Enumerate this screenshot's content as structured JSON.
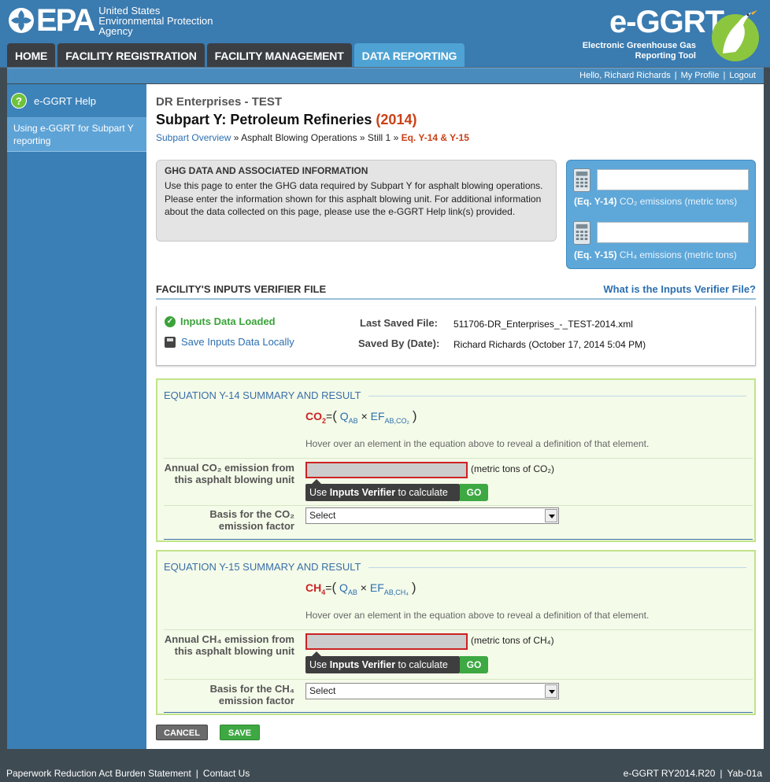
{
  "header": {
    "epa_word": "EPA",
    "agency_line1": "United States",
    "agency_line2": "Environmental Protection",
    "agency_line3": "Agency",
    "app_title": "e-GGRT",
    "app_subtitle_line1": "Electronic Greenhouse Gas",
    "app_subtitle_line2": "Reporting Tool",
    "nav_tabs": [
      "HOME",
      "FACILITY REGISTRATION",
      "FACILITY MANAGEMENT",
      "DATA REPORTING"
    ],
    "active_tab": "DATA REPORTING"
  },
  "userbar": {
    "greeting": "Hello, Richard Richards",
    "profile": "My Profile",
    "logout": "Logout"
  },
  "sidebar": {
    "help_label": "e-GGRT Help",
    "help_icon": "question-icon",
    "link": "Using e-GGRT for Subpart Y reporting"
  },
  "page": {
    "company": "DR Enterprises - TEST",
    "subpart": "Subpart Y: Petroleum Refineries",
    "year": "(2014)",
    "breadcrumb": {
      "overview": "Subpart Overview",
      "sep": "»",
      "step1": "Asphalt Blowing Operations",
      "step2": "Still 1",
      "current": "Eq. Y-14 & Y-15"
    }
  },
  "ghg_box": {
    "title": "GHG DATA AND ASSOCIATED INFORMATION",
    "text": "Use this page to enter the GHG data required by Subpart Y for asphalt blowing operations. Please enter the information shown for this asphalt blowing unit. For additional information about the data collected on this page, please use the e-GGRT Help link(s) provided."
  },
  "calc_box": {
    "y14_eq": "(Eq. Y-14)",
    "y14_label": "CO₂ emissions (metric tons)",
    "y14_value": "",
    "y15_eq": "(Eq. Y-15)",
    "y15_label": "CH₄ emissions (metric tons)",
    "y15_value": ""
  },
  "ivf": {
    "title": "FACILITY'S INPUTS VERIFIER FILE",
    "link": "What is the Inputs Verifier File?",
    "loaded": "Inputs Data Loaded",
    "save_local": "Save Inputs Data Locally",
    "last_saved_label": "Last Saved File:",
    "last_saved_value": "511706-DR_Enterprises_-_TEST-2014.xml",
    "saved_by_label": "Saved By (Date):",
    "saved_by_value": "Richard Richards (October 17, 2014 5:04 PM)"
  },
  "eq14": {
    "title": "EQUATION Y-14 SUMMARY AND RESULT",
    "gas": "CO",
    "gas_sub": "2",
    "q": "Q",
    "q_sub": "AB",
    "ef": "EF",
    "ef_sub": "AB,CO₂",
    "hover_note": "Hover over an element in the equation above to reveal a definition of that element.",
    "field_label": "Annual CO₂ emission from this asphalt blowing unit",
    "field_value": "",
    "unit": "(metric tons of CO₂)",
    "tip_prefix": "Use ",
    "tip_bold": "Inputs Verifier",
    "tip_suffix": " to calculate",
    "go": "GO",
    "basis_label": "Basis for the CO₂ emission factor",
    "basis_value": "Select"
  },
  "eq15": {
    "title": "EQUATION Y-15 SUMMARY AND RESULT",
    "gas": "CH",
    "gas_sub": "4",
    "q": "Q",
    "q_sub": "AB",
    "ef": "EF",
    "ef_sub": "AB,CH₄",
    "hover_note": "Hover over an element in the equation above to reveal a definition of that element.",
    "field_label": "Annual CH₄ emission from this asphalt blowing unit",
    "field_value": "",
    "unit": "(metric tons of CH₄)",
    "tip_prefix": "Use ",
    "tip_bold": "Inputs Verifier",
    "tip_suffix": " to calculate",
    "go": "GO",
    "basis_label": "Basis for the CH₄ emission factor",
    "basis_value": "Select"
  },
  "buttons": {
    "cancel": "CANCEL",
    "save": "SAVE"
  },
  "footer": {
    "paperwork": "Paperwork Reduction Act Burden Statement",
    "contact": "Contact Us",
    "version": "e-GGRT RY2014.R20",
    "code": "Yab-01a"
  },
  "colors": {
    "header_blue": "#3a7bb0",
    "sidebar_blue": "#3a80b6",
    "accent_red": "#c94016",
    "link_blue": "#2c6fb0",
    "go_green": "#3ea843"
  }
}
